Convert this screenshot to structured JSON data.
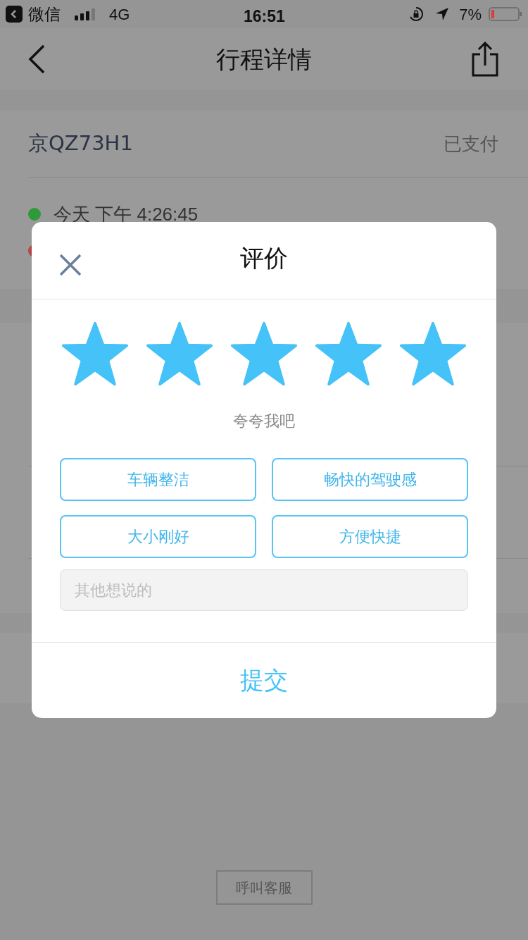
{
  "status_bar": {
    "back_app": "微信",
    "network": "4G",
    "time": "16:51",
    "battery": "7%"
  },
  "nav": {
    "title": "行程详情"
  },
  "trip": {
    "plate": "京QZ73H1",
    "payment_status": "已支付",
    "points": [
      {
        "time": "今天 下午 4:26:45",
        "color": "#2f9a3c"
      },
      {
        "color": "#b04848"
      }
    ]
  },
  "support_button": "呼叫客服",
  "rating_dialog": {
    "title": "评价",
    "stars": 5,
    "prompt": "夸夸我吧",
    "tags": [
      {
        "label": "车辆整洁",
        "selected": false
      },
      {
        "label": "畅快的驾驶感",
        "selected": false
      },
      {
        "label": "大小刚好",
        "selected": false
      },
      {
        "label": "方便快捷",
        "selected": false
      }
    ],
    "comment": {
      "placeholder": "其他想说的"
    },
    "submit": "提交"
  }
}
